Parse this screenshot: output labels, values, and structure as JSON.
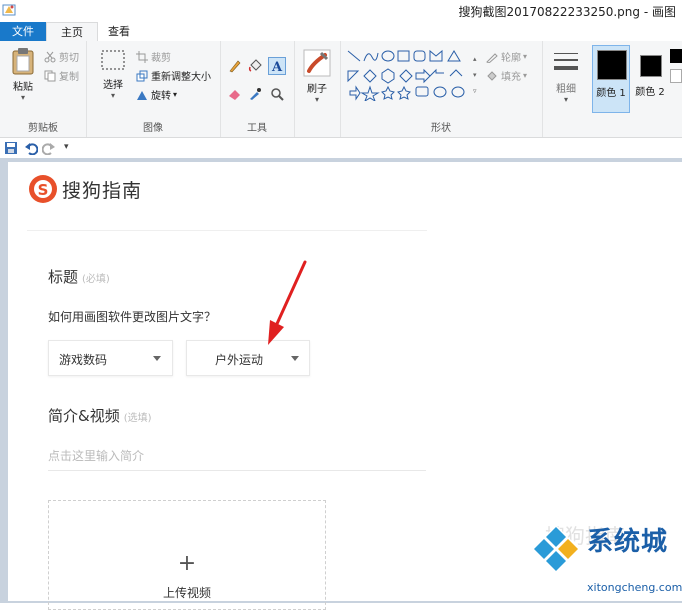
{
  "window": {
    "title": "搜狗截图20170822233250.png - 画图"
  },
  "tabs": {
    "file": "文件",
    "home": "主页",
    "view": "查看"
  },
  "ribbon": {
    "clipboard": {
      "label": "剪贴板",
      "paste": "粘贴",
      "cut": "剪切",
      "copy": "复制"
    },
    "image": {
      "label": "图像",
      "select": "选择",
      "crop": "裁剪",
      "resize": "重新调整大小",
      "rotate": "旋转"
    },
    "tools": {
      "label": "工具"
    },
    "brushes": {
      "label": "刷子"
    },
    "shapes": {
      "label": "形状",
      "outline": "轮廓",
      "fill": "填充"
    },
    "size": {
      "label": "粗细"
    },
    "colors": {
      "color1": "颜色 1",
      "color2": "颜色 2",
      "primary": "#000000",
      "secondary": "#000000"
    }
  },
  "page": {
    "brand": "搜狗指南",
    "title_label": "标题",
    "title_hint": "(必填)",
    "question": "如何用画图软件更改图片文字？",
    "category1": "游戏数码",
    "category2": "户外运动",
    "intro_label": "简介&视频",
    "intro_hint": "(选填)",
    "intro_placeholder": "点击这里输入简介",
    "upload_plus": "+",
    "upload_label": "上传视频"
  },
  "watermark": {
    "text": "搜狗指南",
    "site_name": "系统城",
    "site_url": "xitongcheng.com"
  }
}
